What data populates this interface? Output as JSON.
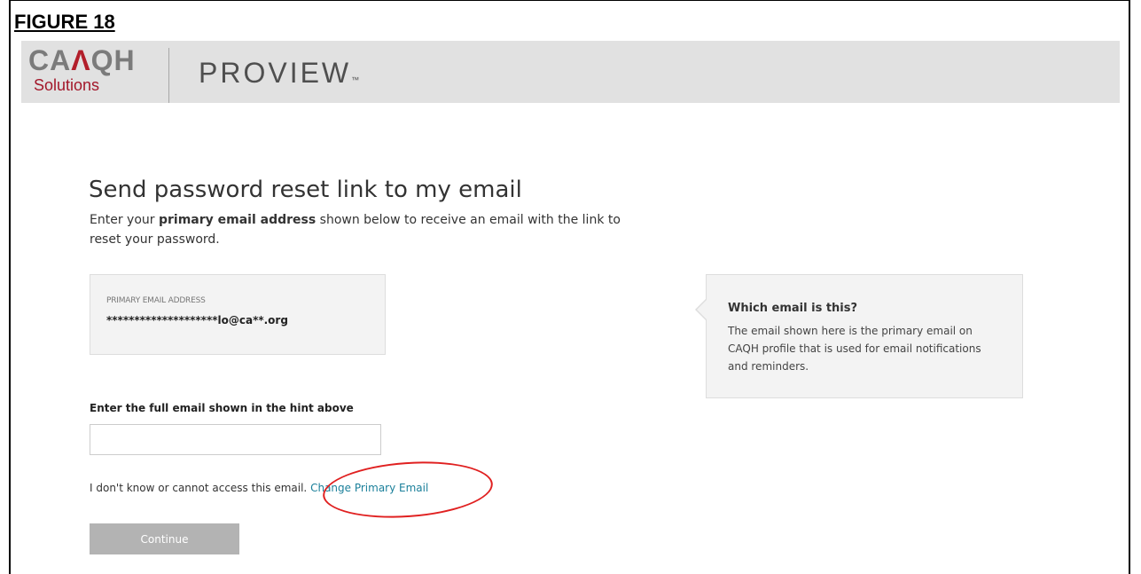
{
  "figure_label": "FIGURE 18",
  "header": {
    "logo_top_main": "CA",
    "logo_top_accent": "Λ",
    "logo_top_rest": "QH",
    "logo_sub": "Solutions",
    "product_name": "PROVIEW",
    "product_tm": "™"
  },
  "main": {
    "title": "Send password reset link to my email",
    "desc_prefix": "Enter your ",
    "desc_bold": "primary email address",
    "desc_suffix": " shown below to receive an email with the link to reset your password.",
    "hint": {
      "label": "PRIMARY EMAIL ADDRESS",
      "value": "********************lo@ca**.org"
    },
    "info": {
      "title": "Which email is this?",
      "text": "The email shown here is the primary email on CAQH profile that is used for email notifications and reminders."
    },
    "field_label": "Enter the full email shown in the hint above",
    "email_value": "",
    "email_placeholder": "",
    "access_text": "I don't know or cannot access this email.",
    "change_link": "Change Primary Email",
    "continue_label": "Continue"
  },
  "colors": {
    "header_bg": "#e1e1e1",
    "brand_red": "#b21e2a",
    "link": "#1a7f9a",
    "annotation": "#e02020",
    "button_disabled": "#b3b3b3"
  }
}
